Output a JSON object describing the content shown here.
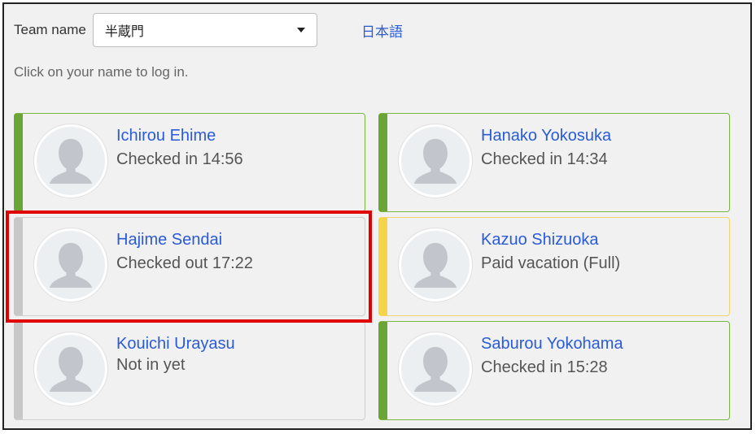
{
  "header": {
    "team_label": "Team name",
    "team_value": "半蔵門",
    "language_link": "日本語"
  },
  "hint": "Click on your name to log in.",
  "members": [
    {
      "name": "Ichirou Ehime",
      "status": "Checked in 14:56",
      "state": "checked-in",
      "color": "#6aa635"
    },
    {
      "name": "Hanako Yokosuka",
      "status": "Checked in 14:34",
      "state": "checked-in",
      "color": "#6aa635"
    },
    {
      "name": "Hajime Sendai",
      "status": "Checked out 17:22",
      "state": "checked-out",
      "color": "#c8c8c8",
      "highlighted": true
    },
    {
      "name": "Kazuo Shizuoka",
      "status": "Paid vacation (Full)",
      "state": "vacation",
      "color": "#f5d547"
    },
    {
      "name": "Kouichi Urayasu",
      "status": "Not in yet",
      "state": "not-in",
      "color": "#c8c8c8"
    },
    {
      "name": "Saburou Yokohama",
      "status": "Checked in 15:28",
      "state": "checked-in",
      "color": "#6aa635"
    }
  ],
  "colors": {
    "link": "#2a5bd7",
    "highlight": "#e00000"
  }
}
